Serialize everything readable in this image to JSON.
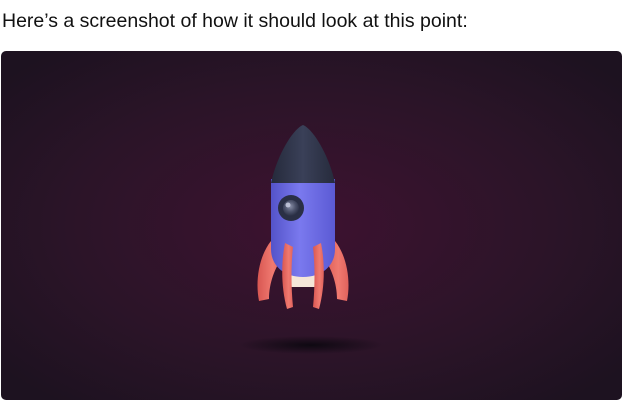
{
  "caption": "Here’s a screenshot of how it should look at this point:",
  "image": {
    "subject": "rocket-illustration",
    "colors": {
      "background_center": "#3d1230",
      "background_edge": "#1d1220",
      "nose_cone": "#2f3447",
      "body": "#6f6ee6",
      "window_ring": "#2a2f45",
      "fins": "#e86a62",
      "exhaust": "#f4e6d8"
    }
  }
}
